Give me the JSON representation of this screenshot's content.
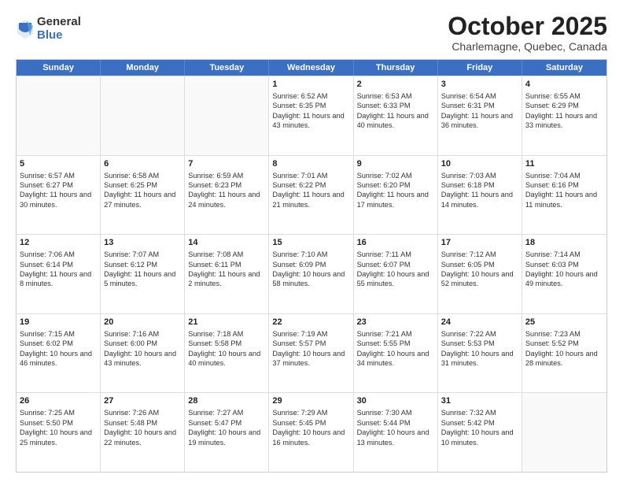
{
  "logo": {
    "general": "General",
    "blue": "Blue"
  },
  "header": {
    "month": "October 2025",
    "location": "Charlemagne, Quebec, Canada"
  },
  "weekdays": [
    "Sunday",
    "Monday",
    "Tuesday",
    "Wednesday",
    "Thursday",
    "Friday",
    "Saturday"
  ],
  "rows": [
    [
      {
        "day": "",
        "sunrise": "",
        "sunset": "",
        "daylight": ""
      },
      {
        "day": "",
        "sunrise": "",
        "sunset": "",
        "daylight": ""
      },
      {
        "day": "",
        "sunrise": "",
        "sunset": "",
        "daylight": ""
      },
      {
        "day": "1",
        "sunrise": "Sunrise: 6:52 AM",
        "sunset": "Sunset: 6:35 PM",
        "daylight": "Daylight: 11 hours and 43 minutes."
      },
      {
        "day": "2",
        "sunrise": "Sunrise: 6:53 AM",
        "sunset": "Sunset: 6:33 PM",
        "daylight": "Daylight: 11 hours and 40 minutes."
      },
      {
        "day": "3",
        "sunrise": "Sunrise: 6:54 AM",
        "sunset": "Sunset: 6:31 PM",
        "daylight": "Daylight: 11 hours and 36 minutes."
      },
      {
        "day": "4",
        "sunrise": "Sunrise: 6:55 AM",
        "sunset": "Sunset: 6:29 PM",
        "daylight": "Daylight: 11 hours and 33 minutes."
      }
    ],
    [
      {
        "day": "5",
        "sunrise": "Sunrise: 6:57 AM",
        "sunset": "Sunset: 6:27 PM",
        "daylight": "Daylight: 11 hours and 30 minutes."
      },
      {
        "day": "6",
        "sunrise": "Sunrise: 6:58 AM",
        "sunset": "Sunset: 6:25 PM",
        "daylight": "Daylight: 11 hours and 27 minutes."
      },
      {
        "day": "7",
        "sunrise": "Sunrise: 6:59 AM",
        "sunset": "Sunset: 6:23 PM",
        "daylight": "Daylight: 11 hours and 24 minutes."
      },
      {
        "day": "8",
        "sunrise": "Sunrise: 7:01 AM",
        "sunset": "Sunset: 6:22 PM",
        "daylight": "Daylight: 11 hours and 21 minutes."
      },
      {
        "day": "9",
        "sunrise": "Sunrise: 7:02 AM",
        "sunset": "Sunset: 6:20 PM",
        "daylight": "Daylight: 11 hours and 17 minutes."
      },
      {
        "day": "10",
        "sunrise": "Sunrise: 7:03 AM",
        "sunset": "Sunset: 6:18 PM",
        "daylight": "Daylight: 11 hours and 14 minutes."
      },
      {
        "day": "11",
        "sunrise": "Sunrise: 7:04 AM",
        "sunset": "Sunset: 6:16 PM",
        "daylight": "Daylight: 11 hours and 11 minutes."
      }
    ],
    [
      {
        "day": "12",
        "sunrise": "Sunrise: 7:06 AM",
        "sunset": "Sunset: 6:14 PM",
        "daylight": "Daylight: 11 hours and 8 minutes."
      },
      {
        "day": "13",
        "sunrise": "Sunrise: 7:07 AM",
        "sunset": "Sunset: 6:12 PM",
        "daylight": "Daylight: 11 hours and 5 minutes."
      },
      {
        "day": "14",
        "sunrise": "Sunrise: 7:08 AM",
        "sunset": "Sunset: 6:11 PM",
        "daylight": "Daylight: 11 hours and 2 minutes."
      },
      {
        "day": "15",
        "sunrise": "Sunrise: 7:10 AM",
        "sunset": "Sunset: 6:09 PM",
        "daylight": "Daylight: 10 hours and 58 minutes."
      },
      {
        "day": "16",
        "sunrise": "Sunrise: 7:11 AM",
        "sunset": "Sunset: 6:07 PM",
        "daylight": "Daylight: 10 hours and 55 minutes."
      },
      {
        "day": "17",
        "sunrise": "Sunrise: 7:12 AM",
        "sunset": "Sunset: 6:05 PM",
        "daylight": "Daylight: 10 hours and 52 minutes."
      },
      {
        "day": "18",
        "sunrise": "Sunrise: 7:14 AM",
        "sunset": "Sunset: 6:03 PM",
        "daylight": "Daylight: 10 hours and 49 minutes."
      }
    ],
    [
      {
        "day": "19",
        "sunrise": "Sunrise: 7:15 AM",
        "sunset": "Sunset: 6:02 PM",
        "daylight": "Daylight: 10 hours and 46 minutes."
      },
      {
        "day": "20",
        "sunrise": "Sunrise: 7:16 AM",
        "sunset": "Sunset: 6:00 PM",
        "daylight": "Daylight: 10 hours and 43 minutes."
      },
      {
        "day": "21",
        "sunrise": "Sunrise: 7:18 AM",
        "sunset": "Sunset: 5:58 PM",
        "daylight": "Daylight: 10 hours and 40 minutes."
      },
      {
        "day": "22",
        "sunrise": "Sunrise: 7:19 AM",
        "sunset": "Sunset: 5:57 PM",
        "daylight": "Daylight: 10 hours and 37 minutes."
      },
      {
        "day": "23",
        "sunrise": "Sunrise: 7:21 AM",
        "sunset": "Sunset: 5:55 PM",
        "daylight": "Daylight: 10 hours and 34 minutes."
      },
      {
        "day": "24",
        "sunrise": "Sunrise: 7:22 AM",
        "sunset": "Sunset: 5:53 PM",
        "daylight": "Daylight: 10 hours and 31 minutes."
      },
      {
        "day": "25",
        "sunrise": "Sunrise: 7:23 AM",
        "sunset": "Sunset: 5:52 PM",
        "daylight": "Daylight: 10 hours and 28 minutes."
      }
    ],
    [
      {
        "day": "26",
        "sunrise": "Sunrise: 7:25 AM",
        "sunset": "Sunset: 5:50 PM",
        "daylight": "Daylight: 10 hours and 25 minutes."
      },
      {
        "day": "27",
        "sunrise": "Sunrise: 7:26 AM",
        "sunset": "Sunset: 5:48 PM",
        "daylight": "Daylight: 10 hours and 22 minutes."
      },
      {
        "day": "28",
        "sunrise": "Sunrise: 7:27 AM",
        "sunset": "Sunset: 5:47 PM",
        "daylight": "Daylight: 10 hours and 19 minutes."
      },
      {
        "day": "29",
        "sunrise": "Sunrise: 7:29 AM",
        "sunset": "Sunset: 5:45 PM",
        "daylight": "Daylight: 10 hours and 16 minutes."
      },
      {
        "day": "30",
        "sunrise": "Sunrise: 7:30 AM",
        "sunset": "Sunset: 5:44 PM",
        "daylight": "Daylight: 10 hours and 13 minutes."
      },
      {
        "day": "31",
        "sunrise": "Sunrise: 7:32 AM",
        "sunset": "Sunset: 5:42 PM",
        "daylight": "Daylight: 10 hours and 10 minutes."
      },
      {
        "day": "",
        "sunrise": "",
        "sunset": "",
        "daylight": ""
      }
    ]
  ]
}
